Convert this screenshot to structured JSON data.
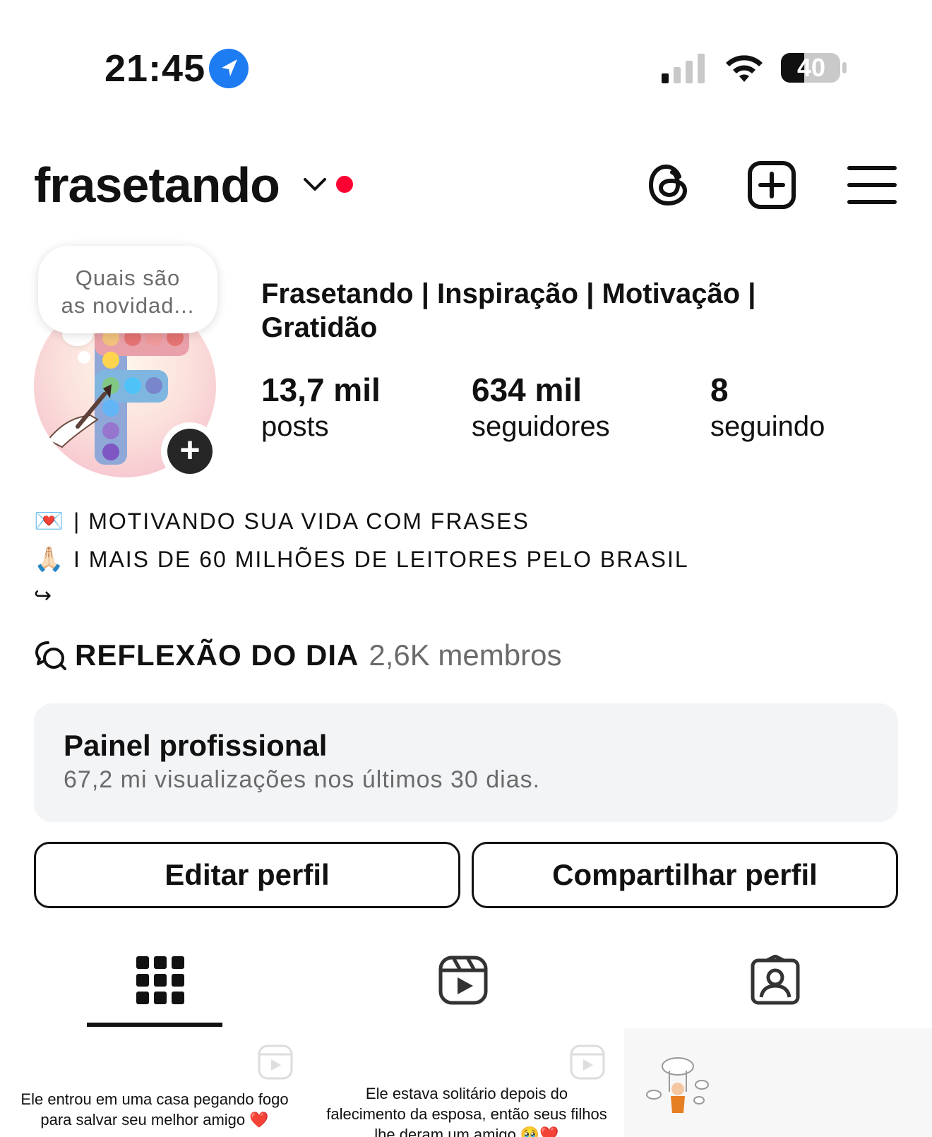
{
  "status_bar": {
    "time": "21:45",
    "battery_level": "40",
    "icons": [
      "location-arrow-icon",
      "cellular-signal-icon",
      "wifi-icon",
      "battery-icon"
    ]
  },
  "header": {
    "username": "frasetando",
    "icons": [
      "chevron-down-icon",
      "notification-dot",
      "threads-icon",
      "new-post-icon",
      "menu-icon"
    ]
  },
  "note": {
    "line1": "Quais são",
    "line2": "as novidad..."
  },
  "profile": {
    "full_name": "Frasetando | Inspiração | Motivação | Gratidão",
    "stats": [
      {
        "value": "13,7 mil",
        "label": "posts"
      },
      {
        "value": "634 mil",
        "label": "seguidores"
      },
      {
        "value": "8",
        "label": "seguindo"
      }
    ]
  },
  "bio": {
    "line1_emoji": "💌",
    "line1_text": "| MOTIVANDO SUA VIDA COM FRASES",
    "line2_emoji": "🙏🏻",
    "line2_text": "I MAIS DE 60 MILHÕES DE LEITORES PELO BRASIL",
    "line3": "↪"
  },
  "channel": {
    "name": "REFLEXÃO DO DIA",
    "members": "2,6K membros"
  },
  "dashboard": {
    "title": "Painel profissional",
    "subtitle": "67,2 mi visualizações nos últimos 30 dias."
  },
  "buttons": {
    "edit": "Editar perfil",
    "share": "Compartilhar perfil"
  },
  "tabs": [
    "grid-icon",
    "reels-icon",
    "tagged-icon"
  ],
  "posts": [
    {
      "text": "Ele entrou em uma casa pegando fogo para salvar seu melhor amigo ❤️"
    },
    {
      "text": "Ele estava solitário depois do falecimento da esposa, então seus filhos lhe deram um amigo 🥹❤️"
    },
    {
      "text": ""
    }
  ],
  "colors": {
    "accent_blue": "#1e7cf2",
    "notification_red": "#ff0033",
    "dashboard_bg": "#f3f4f6",
    "secondary_text": "#6b6b6b"
  }
}
